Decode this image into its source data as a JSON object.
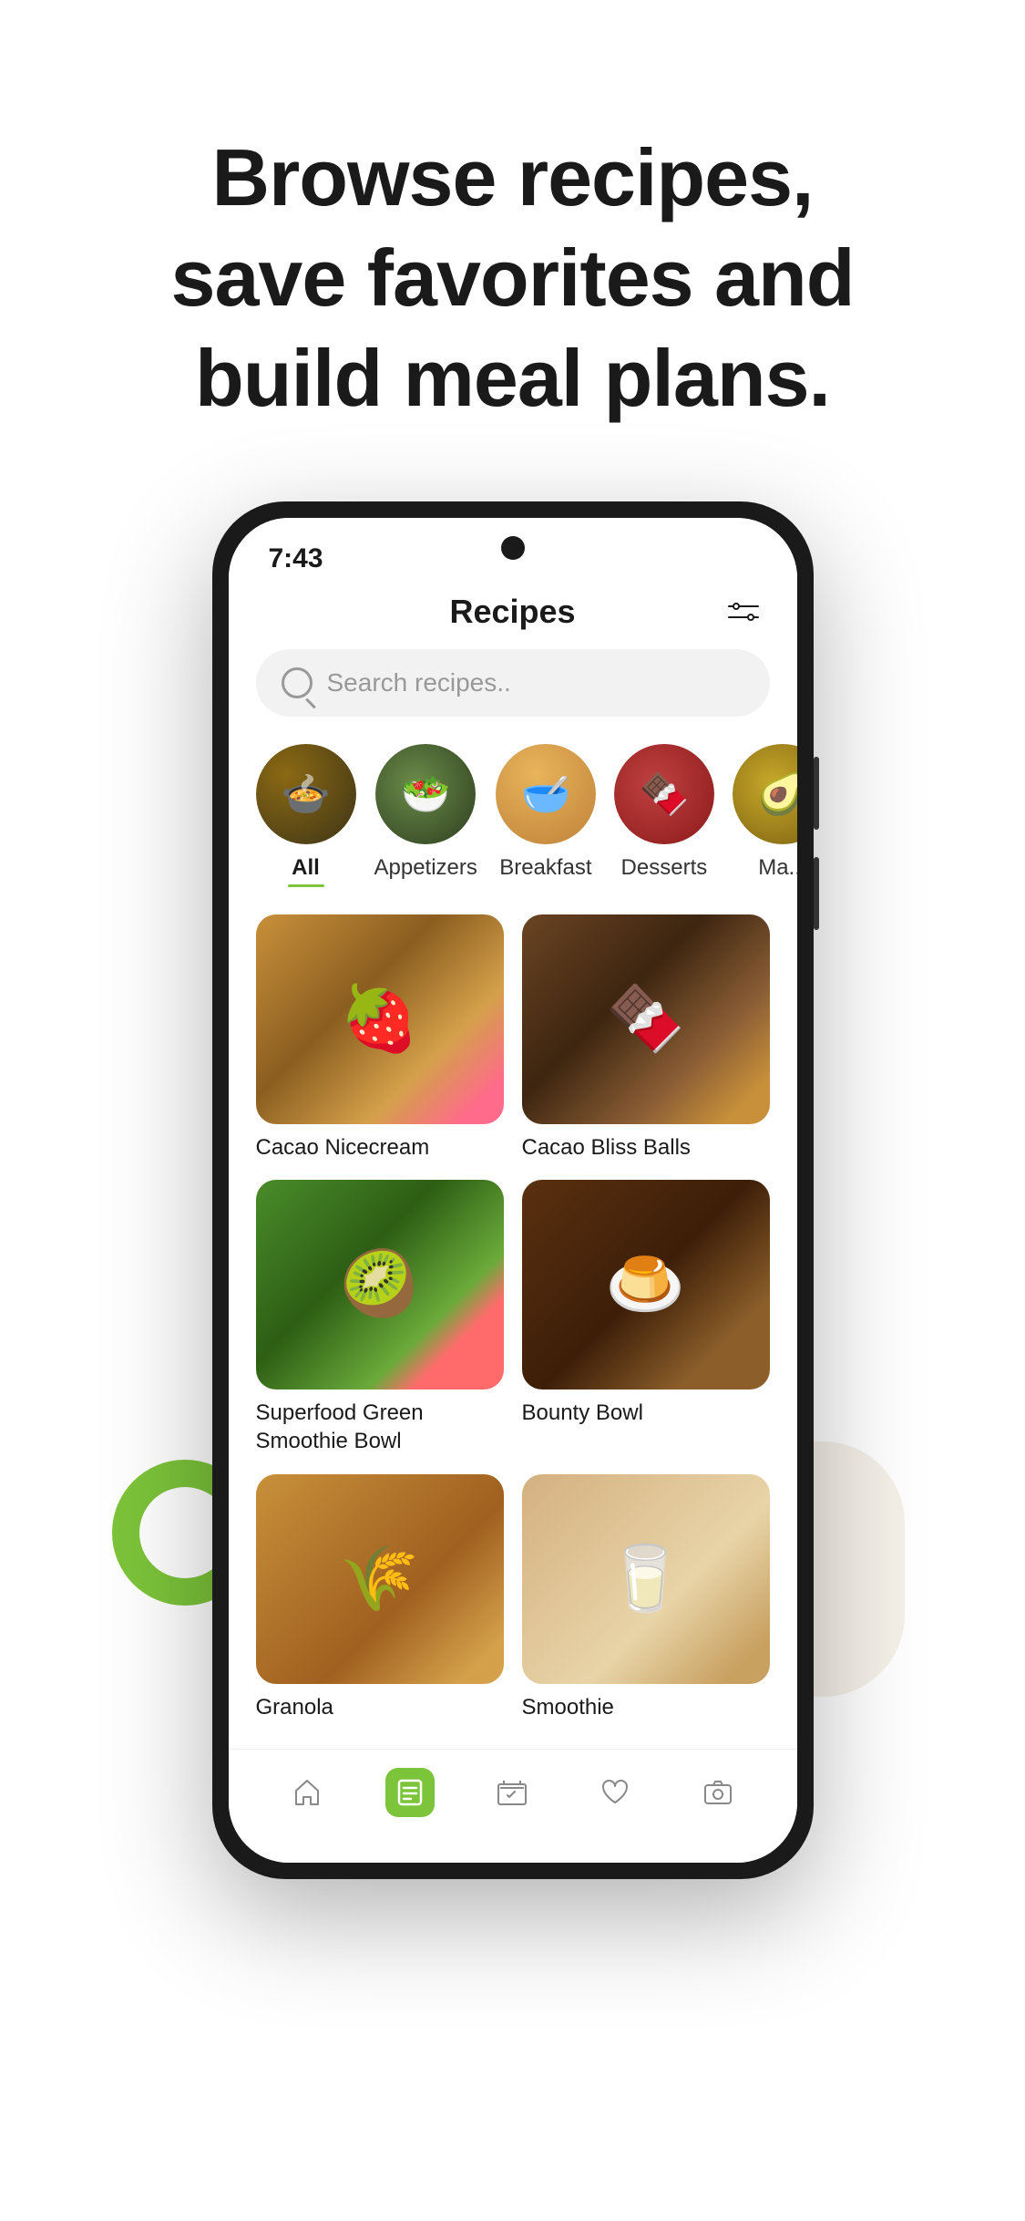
{
  "hero": {
    "title_line1": "Browse recipes,",
    "title_line2": "save favorites and",
    "title_line3": "build meal plans."
  },
  "status_bar": {
    "time": "7:43"
  },
  "app_header": {
    "title": "Recipes"
  },
  "search": {
    "placeholder": "Search recipes.."
  },
  "categories": [
    {
      "id": "all",
      "label": "All",
      "active": true,
      "emoji": "🍲"
    },
    {
      "id": "appetizers",
      "label": "Appetizers",
      "active": false,
      "emoji": "🥗"
    },
    {
      "id": "breakfast",
      "label": "Breakfast",
      "active": false,
      "emoji": "🥣"
    },
    {
      "id": "desserts",
      "label": "Desserts",
      "active": false,
      "emoji": "🍫"
    },
    {
      "id": "more",
      "label": "Ma...",
      "active": false,
      "emoji": "🥑"
    }
  ],
  "recipes": [
    {
      "id": "cacao-nicecream",
      "name": "Cacao Nicecream",
      "img_class": "img-cacao-nice"
    },
    {
      "id": "cacao-bliss-balls",
      "name": "Cacao Bliss Balls",
      "img_class": "img-cacao-bliss"
    },
    {
      "id": "superfood-green",
      "name": "Superfood Green Smoothie Bowl",
      "img_class": "img-superfood"
    },
    {
      "id": "bounty-bowl",
      "name": "Bounty Bowl",
      "img_class": "img-bounty"
    },
    {
      "id": "granola",
      "name": "Granola",
      "img_class": "img-granola"
    },
    {
      "id": "smoothie",
      "name": "Smoothie",
      "img_class": "img-smoothie"
    }
  ],
  "bottom_nav": [
    {
      "id": "home",
      "label": "Home",
      "active": false,
      "icon": "home"
    },
    {
      "id": "recipes-tab",
      "label": "Recipes",
      "active": true,
      "icon": "list"
    },
    {
      "id": "meal-plan",
      "label": "Meal Plan",
      "active": false,
      "icon": "calendar"
    },
    {
      "id": "favorites",
      "label": "Favorites",
      "active": false,
      "icon": "heart"
    },
    {
      "id": "camera",
      "label": "Camera",
      "active": false,
      "icon": "camera"
    }
  ],
  "colors": {
    "accent": "#7cc43a",
    "dark": "#1a1a1a",
    "light_bg": "#f2f2f2"
  }
}
